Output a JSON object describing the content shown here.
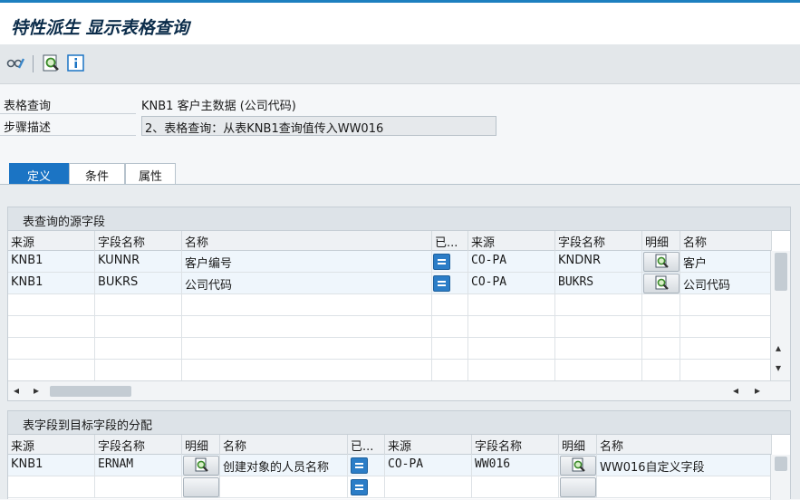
{
  "window": {
    "title": "特性派生 显示表格查询"
  },
  "toolbar": {
    "icons": [
      "glasses-icon",
      "search-detail-icon",
      "info-icon"
    ]
  },
  "form": {
    "table_lookup_label": "表格查询",
    "table_lookup_value": "KNB1 客户主数据 (公司代码)",
    "step_desc_label": "步骤描述",
    "step_desc_value": "2、表格查询：从表KNB1查询值传入WW016"
  },
  "tabs": [
    {
      "label": "定义",
      "active": true
    },
    {
      "label": "条件",
      "active": false
    },
    {
      "label": "属性",
      "active": false
    }
  ],
  "source_panel": {
    "title": "表查询的源字段",
    "columns": [
      "来源",
      "字段名称",
      "名称",
      "已...",
      "来源",
      "字段名称",
      "明细",
      "名称"
    ],
    "rows": [
      {
        "src": "KNB1",
        "field": "KUNNR",
        "name": "客户编号",
        "src2": "CO-PA",
        "field2": "KNDNR",
        "name2": "客户"
      },
      {
        "src": "KNB1",
        "field": "BUKRS",
        "name": "公司代码",
        "src2": "CO-PA",
        "field2": "BUKRS",
        "name2": "公司代码"
      }
    ]
  },
  "target_panel": {
    "title": "表字段到目标字段的分配",
    "columns": [
      "来源",
      "字段名称",
      "明细",
      "名称",
      "已...",
      "来源",
      "字段名称",
      "明细",
      "名称"
    ],
    "rows": [
      {
        "src": "KNB1",
        "field": "ERNAM",
        "name": "创建对象的人员名称",
        "src2": "CO-PA",
        "field2": "WW016",
        "name2": "WW016自定义字段"
      }
    ]
  },
  "colors": {
    "accent": "#1b74c4",
    "title": "#0b2c4a"
  }
}
